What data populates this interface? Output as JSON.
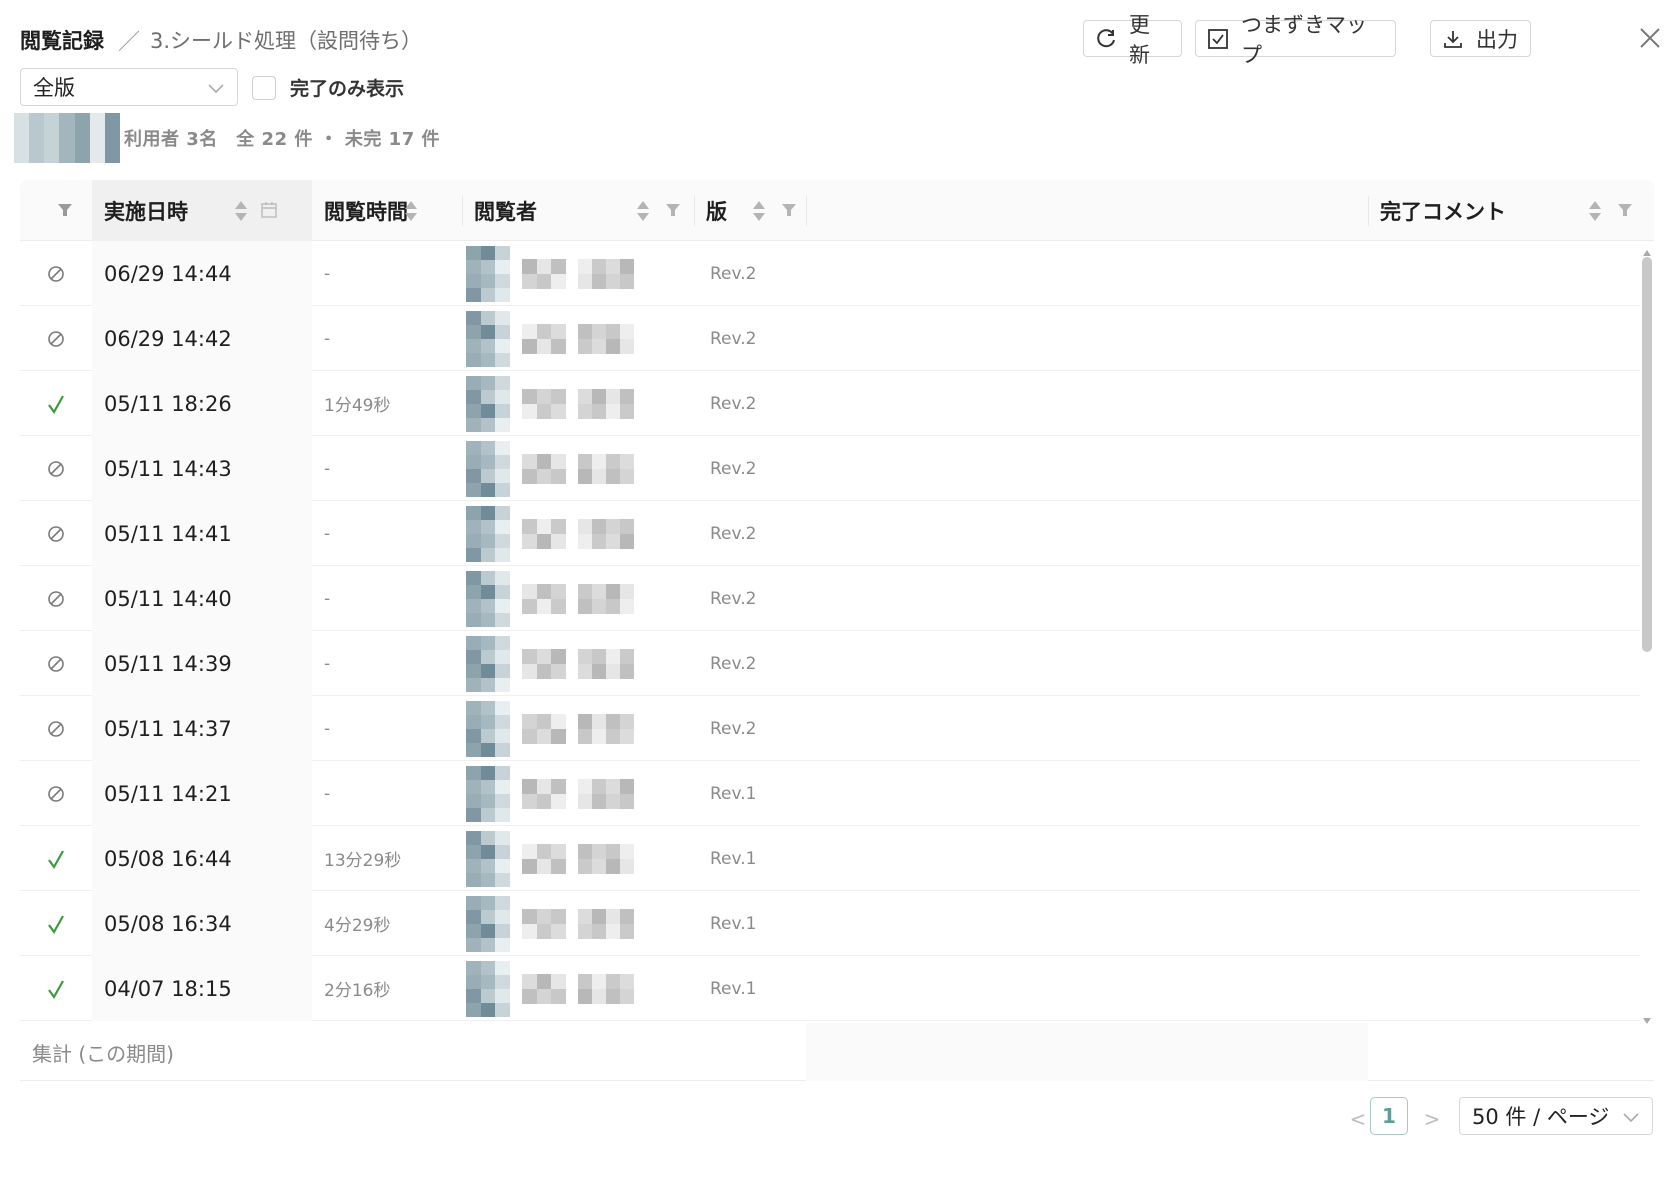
{
  "header": {
    "title": "閲覧記録",
    "separator": "／",
    "subtitle": "3.シールド処理（設問待ち）",
    "refresh_label": "更新",
    "stumble_map_label": "つまずきマップ",
    "export_label": "出力"
  },
  "filters": {
    "version_select_value": "全版",
    "completed_only_label": "完了のみ表示",
    "completed_only_checked": false
  },
  "summary": {
    "text": "利用者 3名　全 22 件 ・ 未完 17 件"
  },
  "table": {
    "columns": {
      "date": "実施日時",
      "duration": "閲覧時間",
      "viewer": "閲覧者",
      "version": "版",
      "comment": "完了コメント"
    },
    "rows": [
      {
        "status": "incomplete",
        "date": "06/29 14:44",
        "duration": "-",
        "version": "Rev.2"
      },
      {
        "status": "incomplete",
        "date": "06/29 14:42",
        "duration": "-",
        "version": "Rev.2"
      },
      {
        "status": "complete",
        "date": "05/11 18:26",
        "duration": "1分49秒",
        "version": "Rev.2"
      },
      {
        "status": "incomplete",
        "date": "05/11 14:43",
        "duration": "-",
        "version": "Rev.2"
      },
      {
        "status": "incomplete",
        "date": "05/11 14:41",
        "duration": "-",
        "version": "Rev.2"
      },
      {
        "status": "incomplete",
        "date": "05/11 14:40",
        "duration": "-",
        "version": "Rev.2"
      },
      {
        "status": "incomplete",
        "date": "05/11 14:39",
        "duration": "-",
        "version": "Rev.2"
      },
      {
        "status": "incomplete",
        "date": "05/11 14:37",
        "duration": "-",
        "version": "Rev.2"
      },
      {
        "status": "incomplete",
        "date": "05/11 14:21",
        "duration": "-",
        "version": "Rev.1"
      },
      {
        "status": "complete",
        "date": "05/08 16:44",
        "duration": "13分29秒",
        "version": "Rev.1"
      },
      {
        "status": "complete",
        "date": "05/08 16:34",
        "duration": "4分29秒",
        "version": "Rev.1"
      },
      {
        "status": "complete",
        "date": "04/07 18:15",
        "duration": "2分16秒",
        "version": "Rev.1"
      }
    ],
    "footer_label": "集計 (この期間)"
  },
  "pagination": {
    "current_page": "1",
    "page_size": "50 件 / ページ",
    "prev_glyph": "<",
    "next_glyph": ">"
  },
  "colors": {
    "complete": "#3d9a3d",
    "incomplete": "#7a7a7a",
    "accent": "#5f9e94"
  }
}
